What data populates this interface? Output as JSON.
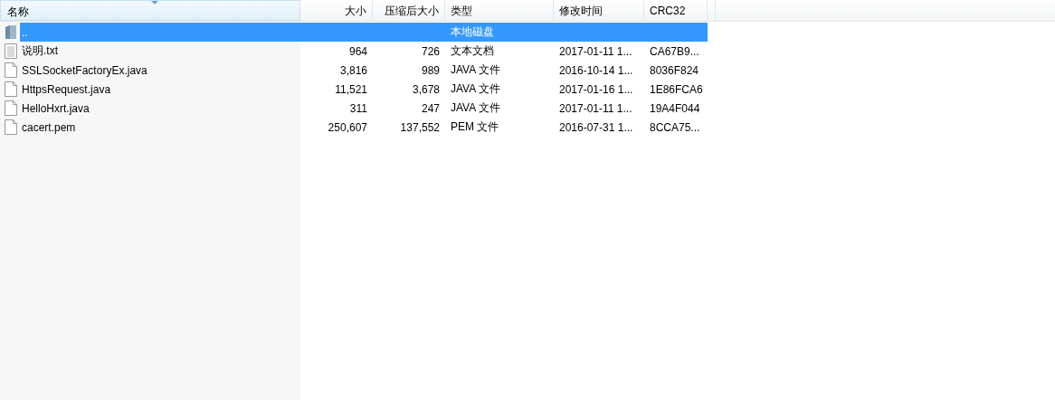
{
  "columns": [
    {
      "label": "名称",
      "sorted": true
    },
    {
      "label": "大小",
      "sorted": false
    },
    {
      "label": "压缩后大小",
      "sorted": false
    },
    {
      "label": "类型",
      "sorted": false
    },
    {
      "label": "修改时间",
      "sorted": false
    },
    {
      "label": "CRC32",
      "sorted": false
    }
  ],
  "rows": [
    {
      "kind": "parent",
      "selected": true,
      "cells": [
        "..",
        "",
        "",
        "本地磁盘",
        "",
        ""
      ]
    },
    {
      "kind": "text",
      "selected": false,
      "cells": [
        "说明.txt",
        "964",
        "726",
        "文本文档",
        "2017-01-11 1...",
        "CA67B9..."
      ]
    },
    {
      "kind": "file",
      "selected": false,
      "cells": [
        "SSLSocketFactoryEx.java",
        "3,816",
        "989",
        "JAVA 文件",
        "2016-10-14 1...",
        "8036F824"
      ]
    },
    {
      "kind": "file",
      "selected": false,
      "cells": [
        "HttpsRequest.java",
        "11,521",
        "3,678",
        "JAVA 文件",
        "2017-01-16 1...",
        "1E86FCA6"
      ]
    },
    {
      "kind": "file",
      "selected": false,
      "cells": [
        "HelloHxrt.java",
        "311",
        "247",
        "JAVA 文件",
        "2017-01-11 1...",
        "19A4F044"
      ]
    },
    {
      "kind": "file",
      "selected": false,
      "cells": [
        "cacert.pem",
        "250,607",
        "137,552",
        "PEM 文件",
        "2016-07-31 1...",
        "8CCA75..."
      ]
    }
  ]
}
